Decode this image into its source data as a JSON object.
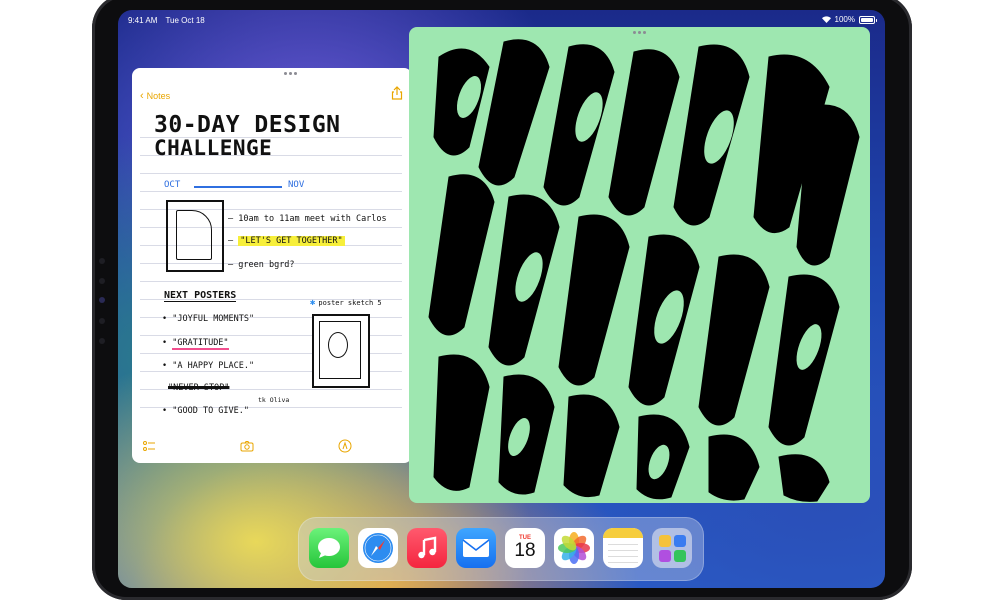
{
  "status_bar": {
    "time": "9:41 AM",
    "date": "Tue Oct 18",
    "battery": "100%"
  },
  "notes_app": {
    "back_label": "Notes",
    "title_line1": "30-DAY DESIGN",
    "title_line2": "CHALLENGE",
    "timeline_start": "OCT",
    "timeline_end": "NOV",
    "tasks": [
      "10am to 11am meet with Carlos",
      "\"LET'S GET TOGETHER\"",
      "green bgrd?"
    ],
    "next_posters_title": "NEXT POSTERS",
    "posters": [
      "\"JOYFUL MOMENTS\"",
      "\"GRATITUDE\"",
      "\"A HAPPY PLACE.\"",
      "\"GOOD TO GIVE.\""
    ],
    "struck_item": "\"NEVER STOP\"",
    "credit": "tk Oliva",
    "sketch_label": "poster sketch 5"
  },
  "dock": {
    "apps": [
      {
        "name": "Messages",
        "icon": "messages-icon"
      },
      {
        "name": "Safari",
        "icon": "safari-icon"
      },
      {
        "name": "Music",
        "icon": "music-icon"
      },
      {
        "name": "Mail",
        "icon": "mail-icon"
      },
      {
        "name": "Calendar",
        "icon": "calendar-icon",
        "day": "TUE",
        "date": "18"
      },
      {
        "name": "Photos",
        "icon": "photos-icon"
      },
      {
        "name": "Notes",
        "icon": "notes-icon"
      },
      {
        "name": "App Library",
        "icon": "app-library-icon"
      }
    ]
  },
  "colors": {
    "accent": "#e9a600",
    "poster_bg": "#9ee7b0",
    "highlight": "#f7ef3a",
    "ink_blue": "#2f6fe0",
    "pink": "#f24f8e"
  }
}
